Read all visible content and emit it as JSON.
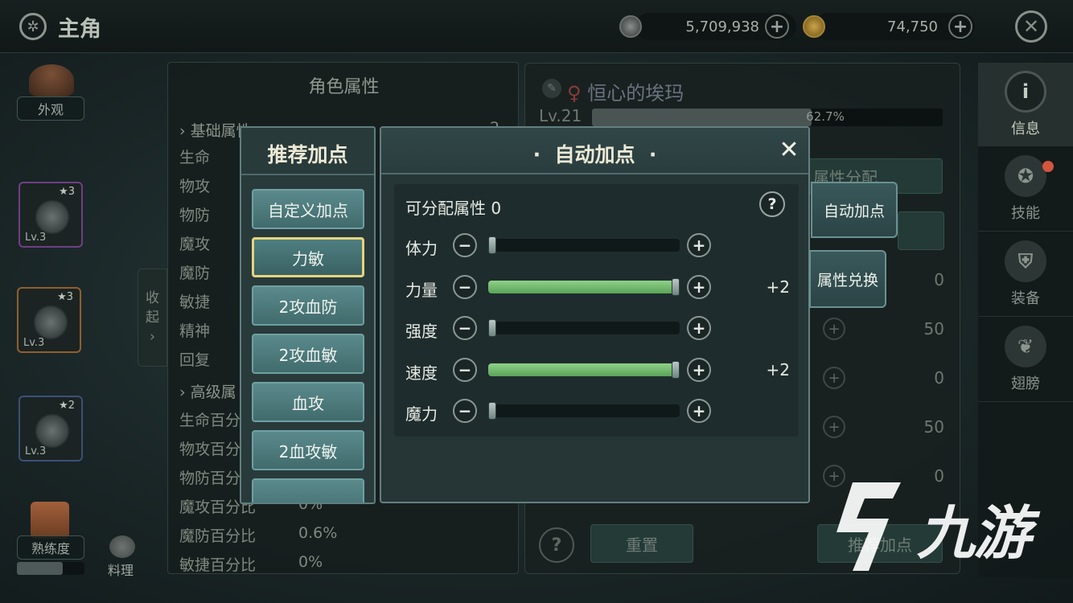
{
  "top_bar": {
    "title": "主角",
    "silver_amount": "5,709,938",
    "gold_amount": "74,750",
    "silver_icon": "silver-coin-icon",
    "gold_icon": "gold-coin-icon"
  },
  "left_column": {
    "appearance_label": "外观",
    "slots": [
      {
        "stars": "★3",
        "level": "Lv.3"
      },
      {
        "stars": "★3",
        "level": "Lv.3"
      },
      {
        "stars": "★2",
        "level": "Lv.3"
      }
    ],
    "proficiency_label": "熟练度",
    "cooking_label": "料理"
  },
  "attr_panel": {
    "title": "角色属性",
    "basic_section": "基础属性",
    "basic_count": "2",
    "basic_rows": [
      "生命",
      "物攻",
      "物防",
      "魔攻",
      "魔防",
      "敏捷",
      "精神",
      "回复"
    ],
    "advanced_section": "高级属",
    "advanced_rows": [
      {
        "label": "生命百分",
        "value": ""
      },
      {
        "label": "物攻百分",
        "value": ""
      },
      {
        "label": "物防百分",
        "value": ""
      },
      {
        "label": "魔攻百分比",
        "value": "0%"
      },
      {
        "label": "魔防百分比",
        "value": "0.6%"
      },
      {
        "label": "敏捷百分比",
        "value": "0%"
      }
    ],
    "collapse_label_1": "收",
    "collapse_label_2": "起"
  },
  "character": {
    "name": "恒心的埃玛",
    "level": "Lv.21",
    "xp_percent_text": "62.7%",
    "xp_fraction": 0.627,
    "attr_alloc_label": "属性分配",
    "bg_values": [
      "0",
      "50",
      "0",
      "50",
      "0"
    ],
    "reset_label": "重置",
    "recommend_label": "推荐加点"
  },
  "right_nav": [
    {
      "label": "信息",
      "icon": "info-icon"
    },
    {
      "label": "技能",
      "icon": "skill-icon"
    },
    {
      "label": "装备",
      "icon": "armor-icon"
    },
    {
      "label": "翅膀",
      "icon": "wings-icon"
    }
  ],
  "recommend_dialog": {
    "title": "推荐加点",
    "options": [
      "自定义加点",
      "力敏",
      "2攻血防",
      "2攻血敏",
      "血攻",
      "2血攻敏"
    ],
    "selected_index": 1
  },
  "auto_dialog": {
    "title": "自动加点",
    "available_label": "可分配属性",
    "available_value": "0",
    "stats": [
      {
        "label": "体力",
        "fraction": 0,
        "delta": ""
      },
      {
        "label": "力量",
        "fraction": 1,
        "delta": "+2"
      },
      {
        "label": "强度",
        "fraction": 0,
        "delta": ""
      },
      {
        "label": "速度",
        "fraction": 1,
        "delta": "+2"
      },
      {
        "label": "魔力",
        "fraction": 0,
        "delta": ""
      }
    ]
  },
  "side_tabs": {
    "auto_add": "自动加点",
    "attr_exchange": "属性兑换"
  },
  "watermark": {
    "text": "九游"
  },
  "colors": {
    "bar_green": "#6cb86a",
    "selected_border": "#e6d37e",
    "button_teal": "#4f7f81"
  }
}
